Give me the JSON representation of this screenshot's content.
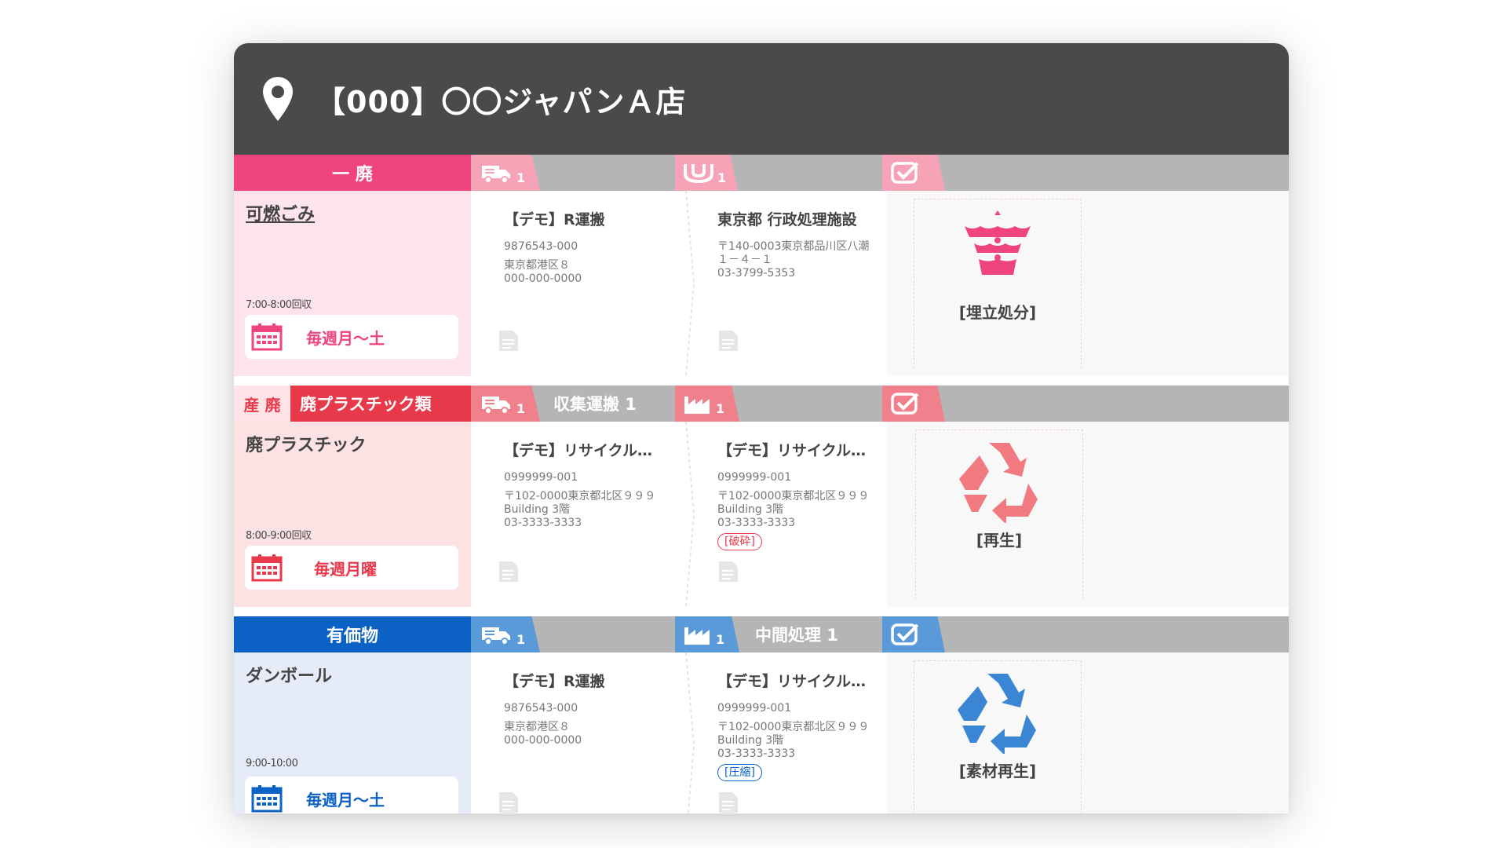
{
  "store": {
    "title": "【000】〇〇ジャパンＡ店",
    "icon": "location-pin-icon"
  },
  "colors": {
    "header": "#4a4a4a",
    "pink": "#f0457c",
    "red": "#e8394b",
    "blue": "#0b62c4",
    "gray_bar": "#b5b5b5"
  },
  "sections": [
    {
      "tag": "一 廃",
      "waste_name": "可燃ごみ",
      "time": "7:00-8:00回収",
      "schedule": "毎週月～土",
      "transport_count": "1",
      "intermediate_count": "1",
      "transporter": {
        "name": "【デモ】R運搬",
        "code": "9876543-000",
        "address": "東京都港区８\n000-000-0000"
      },
      "processor": {
        "name": "東京都 行政処理施設",
        "address": "〒140-0003東京都品川区八潮\n１－４－１\n03-3799-5353"
      },
      "final": "[埋立処分]"
    },
    {
      "tag_a": "産 廃",
      "tag_b": "廃プラスチック類",
      "waste_name": "廃プラスチック",
      "time": "8:00-9:00回収",
      "schedule": "毎週月曜",
      "transport_count": "1",
      "transport_label": "収集運搬 1",
      "intermediate_count": "1",
      "transporter": {
        "name": "【デモ】リサイクル…",
        "code": "0999999-001",
        "address": "〒102-0000東京都北区９９９\nBuilding 3階\n03-3333-3333"
      },
      "processor": {
        "name": "【デモ】リサイクル…",
        "code": "0999999-001",
        "address": "〒102-0000東京都北区９９９\nBuilding 3階\n03-3333-3333",
        "badge": "[破砕]"
      },
      "final": "[再生]"
    },
    {
      "tag": "有価物",
      "waste_name": "ダンボール",
      "time": "9:00-10:00",
      "schedule": "毎週月～土",
      "transport_count": "1",
      "intermediate_count": "1",
      "intermediate_label": "中間処理 1",
      "transporter": {
        "name": "【デモ】R運搬",
        "code": "9876543-000",
        "address": "東京都港区８\n000-000-0000"
      },
      "processor": {
        "name": "【デモ】リサイクル…",
        "code": "0999999-001",
        "address": "〒102-0000東京都北区９９９\nBuilding 3階\n03-3333-3333",
        "badge": "[圧縮]"
      },
      "final": "[素材再生]"
    }
  ]
}
